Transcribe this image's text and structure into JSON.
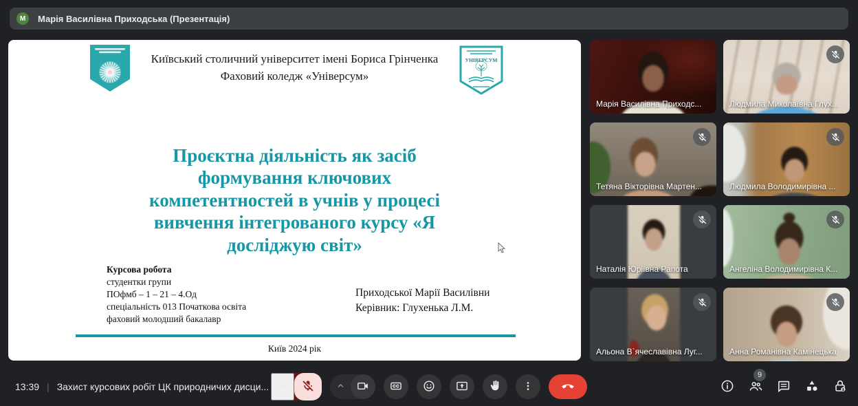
{
  "colors": {
    "accent_teal": "#1697a6",
    "logo_teal": "#2ba8ac",
    "end_call_red": "#e54235",
    "mic_muted_bg": "#f9dedc",
    "mic_muted_glyph": "#8c1d18",
    "avatar_green": "#4d853e",
    "app_background": "#202124",
    "banner_background": "#3c4043"
  },
  "top_bar": {
    "avatar_letter": "M",
    "presenter_label": "Марія Василівна Приходська (Презентація)"
  },
  "slide": {
    "university_lines": [
      "Київський столичний університет імені Бориса Грінченка",
      "Фаховий коледж «Універсум»"
    ],
    "logo_right_label": "УНІВЕРСУМ",
    "title_lines": [
      "Проєктна діяльність як засіб",
      "формування ключових",
      "компетентностей в учнів у процесі",
      "вивчення інтегрованого курсу «Я",
      "досліджую світ»"
    ],
    "work_heading": "Курсова робота",
    "work_lines": [
      "студентки групи",
      "ПОфмб – 1 – 21 – 4.Од",
      "спеціальність 013 Початкова освіта",
      "фаховий молодший бакалавр"
    ],
    "author_lines": [
      "Приходської Марії Василівни",
      "Керівник: Глухенька Л.М."
    ],
    "footer": "Київ 2024 рік"
  },
  "participants": [
    {
      "name": "Марія Василівна Приходс...",
      "muted": false
    },
    {
      "name": "Людмила Миколаївна Глух...",
      "muted": true
    },
    {
      "name": "Тетяна Вікторівна Мартен...",
      "muted": true
    },
    {
      "name": "Людмила Володимирівна ...",
      "muted": true
    },
    {
      "name": "Наталія Юріївна Рапота",
      "muted": true
    },
    {
      "name": "Ангеліна Володимирівна К...",
      "muted": true
    },
    {
      "name": "Альона В`ячеславівна Луг...",
      "muted": true
    },
    {
      "name": "Анна Романівна Камінецька",
      "muted": true
    }
  ],
  "bottom_bar": {
    "time": "13:39",
    "separator": "|",
    "meeting_title": "Захист курсових робіт ЦК природничих дисци...",
    "participant_count": "9"
  },
  "icons": {
    "mic_muted": "mic-off",
    "camera": "videocam",
    "captions": "closed-captions",
    "reactions": "smiley-face",
    "present": "present-screen",
    "raise_hand": "raised-hand",
    "more": "three-dots-vertical",
    "end_call": "phone-down",
    "info": "info-circle",
    "people": "two-people",
    "chat": "chat-bubble",
    "activities": "shapes-triangle-square-circle",
    "host_controls": "lock-with-person",
    "chevron": "chevron-up",
    "tile_mic": "mic-off"
  }
}
